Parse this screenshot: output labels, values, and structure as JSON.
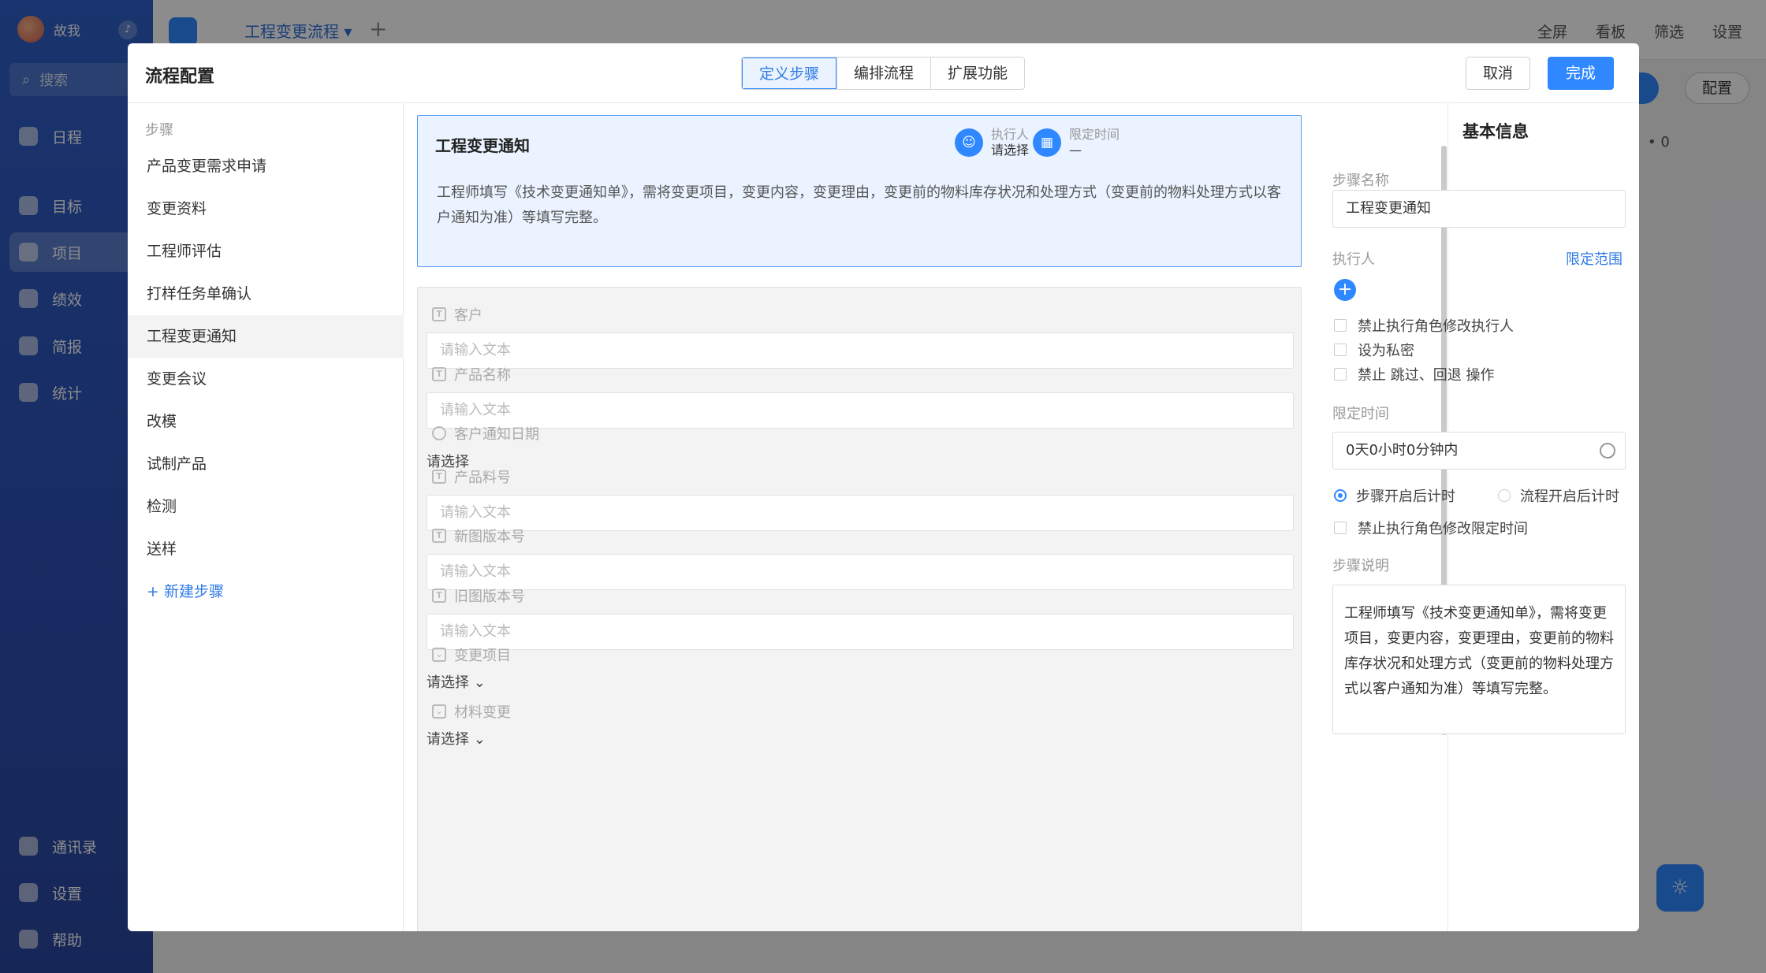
{
  "app": {
    "user_name": "故我",
    "search_placeholder": "搜索",
    "nav": [
      "日程",
      "目标",
      "项目",
      "绩效",
      "简报",
      "统计"
    ],
    "bottom_nav": [
      "通讯录",
      "设置",
      "帮助"
    ],
    "project_title": "工程变更流程",
    "top_actions": [
      "全屏",
      "看板",
      "筛选",
      "设置"
    ],
    "config_label": "配置",
    "count": "• 0"
  },
  "modal": {
    "title": "流程配置",
    "tabs": [
      "定义步骤",
      "编排流程",
      "扩展功能"
    ],
    "active_tab": 0,
    "cancel_label": "取消",
    "done_label": "完成"
  },
  "steps": {
    "header": "步骤",
    "items": [
      "产品变更需求申请",
      "变更资料",
      "工程师评估",
      "打样任务单确认",
      "工程变更通知",
      "变更会议",
      "改模",
      "试制产品",
      "检测",
      "送样"
    ],
    "active_index": 4,
    "new_step_label": "+ 新建步骤"
  },
  "card": {
    "title": "工程变更通知",
    "assignee_label": "执行人",
    "assignee_value": "请选择",
    "deadline_label": "限定时间",
    "deadline_value": "—",
    "description": "工程师填写《技术变更通知单》，需将变更项目，变更内容，变更理由，变更前的物料库存状况和处理方式（变更前的物料处理方式以客户通知为准）等填写完整。"
  },
  "form": {
    "text_placeholder": "请输入文本",
    "select_placeholder": "请选择",
    "fields": [
      {
        "label": "客户",
        "type": "text"
      },
      {
        "label": "产品名称",
        "type": "text"
      },
      {
        "label": "客户通知日期",
        "type": "date"
      },
      {
        "label": "产品料号",
        "type": "text"
      },
      {
        "label": "新图版本号",
        "type": "text"
      },
      {
        "label": "旧图版本号",
        "type": "text"
      },
      {
        "label": "变更项目",
        "type": "select"
      },
      {
        "label": "材料变更",
        "type": "select"
      }
    ]
  },
  "basic_info": {
    "title": "基本信息",
    "step_name_label": "步骤名称",
    "step_name_value": "工程变更通知",
    "assignee_label": "执行人",
    "limit_scope_link": "限定范围",
    "options": [
      "禁止执行角色修改执行人",
      "设为私密",
      "禁止 跳过、回退 操作"
    ],
    "time_limit_label": "限定时间",
    "time_limit_value": "0天0小时0分钟内",
    "timer_options": [
      "步骤开启后计时",
      "流程开启后计时"
    ],
    "timer_selected": 0,
    "forbid_time_edit": "禁止执行角色修改限定时间",
    "description_label": "步骤说明",
    "description": "工程师填写《技术变更通知单》，需将变更项目，变更内容，变更理由，变更前的物料库存状况和处理方式（变更前的物料处理方式以客户通知为准）等填写完整。"
  },
  "colors": {
    "primary": "#2f88ff",
    "sidebar": "#2c4fb3",
    "card_bg": "#eaf3ff",
    "form_bg": "#f3f3f3"
  }
}
